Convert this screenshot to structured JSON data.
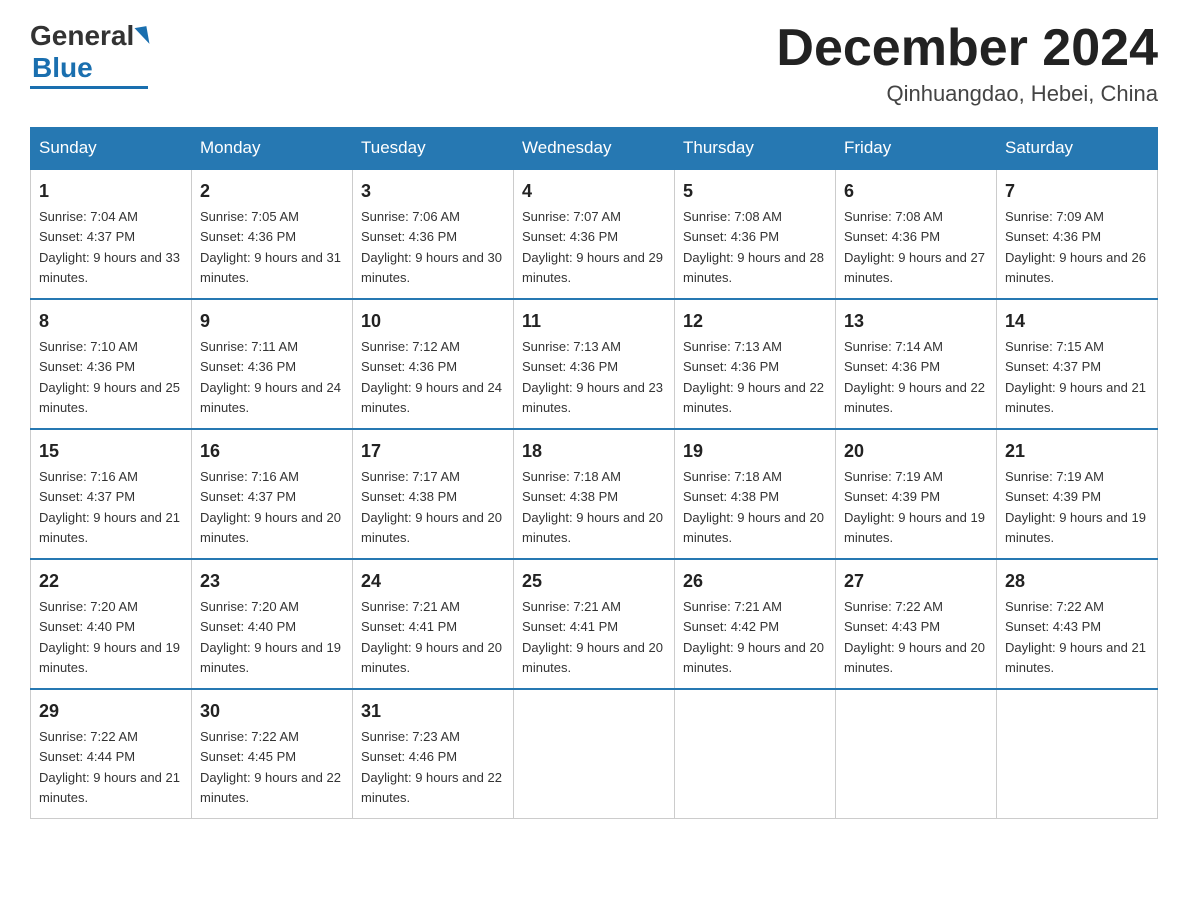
{
  "header": {
    "logo_general": "General",
    "logo_blue": "Blue",
    "month_title": "December 2024",
    "location": "Qinhuangdao, Hebei, China"
  },
  "days_of_week": [
    "Sunday",
    "Monday",
    "Tuesday",
    "Wednesday",
    "Thursday",
    "Friday",
    "Saturday"
  ],
  "weeks": [
    [
      {
        "day": "1",
        "sunrise": "7:04 AM",
        "sunset": "4:37 PM",
        "daylight": "9 hours and 33 minutes."
      },
      {
        "day": "2",
        "sunrise": "7:05 AM",
        "sunset": "4:36 PM",
        "daylight": "9 hours and 31 minutes."
      },
      {
        "day": "3",
        "sunrise": "7:06 AM",
        "sunset": "4:36 PM",
        "daylight": "9 hours and 30 minutes."
      },
      {
        "day": "4",
        "sunrise": "7:07 AM",
        "sunset": "4:36 PM",
        "daylight": "9 hours and 29 minutes."
      },
      {
        "day": "5",
        "sunrise": "7:08 AM",
        "sunset": "4:36 PM",
        "daylight": "9 hours and 28 minutes."
      },
      {
        "day": "6",
        "sunrise": "7:08 AM",
        "sunset": "4:36 PM",
        "daylight": "9 hours and 27 minutes."
      },
      {
        "day": "7",
        "sunrise": "7:09 AM",
        "sunset": "4:36 PM",
        "daylight": "9 hours and 26 minutes."
      }
    ],
    [
      {
        "day": "8",
        "sunrise": "7:10 AM",
        "sunset": "4:36 PM",
        "daylight": "9 hours and 25 minutes."
      },
      {
        "day": "9",
        "sunrise": "7:11 AM",
        "sunset": "4:36 PM",
        "daylight": "9 hours and 24 minutes."
      },
      {
        "day": "10",
        "sunrise": "7:12 AM",
        "sunset": "4:36 PM",
        "daylight": "9 hours and 24 minutes."
      },
      {
        "day": "11",
        "sunrise": "7:13 AM",
        "sunset": "4:36 PM",
        "daylight": "9 hours and 23 minutes."
      },
      {
        "day": "12",
        "sunrise": "7:13 AM",
        "sunset": "4:36 PM",
        "daylight": "9 hours and 22 minutes."
      },
      {
        "day": "13",
        "sunrise": "7:14 AM",
        "sunset": "4:36 PM",
        "daylight": "9 hours and 22 minutes."
      },
      {
        "day": "14",
        "sunrise": "7:15 AM",
        "sunset": "4:37 PM",
        "daylight": "9 hours and 21 minutes."
      }
    ],
    [
      {
        "day": "15",
        "sunrise": "7:16 AM",
        "sunset": "4:37 PM",
        "daylight": "9 hours and 21 minutes."
      },
      {
        "day": "16",
        "sunrise": "7:16 AM",
        "sunset": "4:37 PM",
        "daylight": "9 hours and 20 minutes."
      },
      {
        "day": "17",
        "sunrise": "7:17 AM",
        "sunset": "4:38 PM",
        "daylight": "9 hours and 20 minutes."
      },
      {
        "day": "18",
        "sunrise": "7:18 AM",
        "sunset": "4:38 PM",
        "daylight": "9 hours and 20 minutes."
      },
      {
        "day": "19",
        "sunrise": "7:18 AM",
        "sunset": "4:38 PM",
        "daylight": "9 hours and 20 minutes."
      },
      {
        "day": "20",
        "sunrise": "7:19 AM",
        "sunset": "4:39 PM",
        "daylight": "9 hours and 19 minutes."
      },
      {
        "day": "21",
        "sunrise": "7:19 AM",
        "sunset": "4:39 PM",
        "daylight": "9 hours and 19 minutes."
      }
    ],
    [
      {
        "day": "22",
        "sunrise": "7:20 AM",
        "sunset": "4:40 PM",
        "daylight": "9 hours and 19 minutes."
      },
      {
        "day": "23",
        "sunrise": "7:20 AM",
        "sunset": "4:40 PM",
        "daylight": "9 hours and 19 minutes."
      },
      {
        "day": "24",
        "sunrise": "7:21 AM",
        "sunset": "4:41 PM",
        "daylight": "9 hours and 20 minutes."
      },
      {
        "day": "25",
        "sunrise": "7:21 AM",
        "sunset": "4:41 PM",
        "daylight": "9 hours and 20 minutes."
      },
      {
        "day": "26",
        "sunrise": "7:21 AM",
        "sunset": "4:42 PM",
        "daylight": "9 hours and 20 minutes."
      },
      {
        "day": "27",
        "sunrise": "7:22 AM",
        "sunset": "4:43 PM",
        "daylight": "9 hours and 20 minutes."
      },
      {
        "day": "28",
        "sunrise": "7:22 AM",
        "sunset": "4:43 PM",
        "daylight": "9 hours and 21 minutes."
      }
    ],
    [
      {
        "day": "29",
        "sunrise": "7:22 AM",
        "sunset": "4:44 PM",
        "daylight": "9 hours and 21 minutes."
      },
      {
        "day": "30",
        "sunrise": "7:22 AM",
        "sunset": "4:45 PM",
        "daylight": "9 hours and 22 minutes."
      },
      {
        "day": "31",
        "sunrise": "7:23 AM",
        "sunset": "4:46 PM",
        "daylight": "9 hours and 22 minutes."
      },
      null,
      null,
      null,
      null
    ]
  ],
  "labels": {
    "sunrise_prefix": "Sunrise: ",
    "sunset_prefix": "Sunset: ",
    "daylight_prefix": "Daylight: "
  }
}
